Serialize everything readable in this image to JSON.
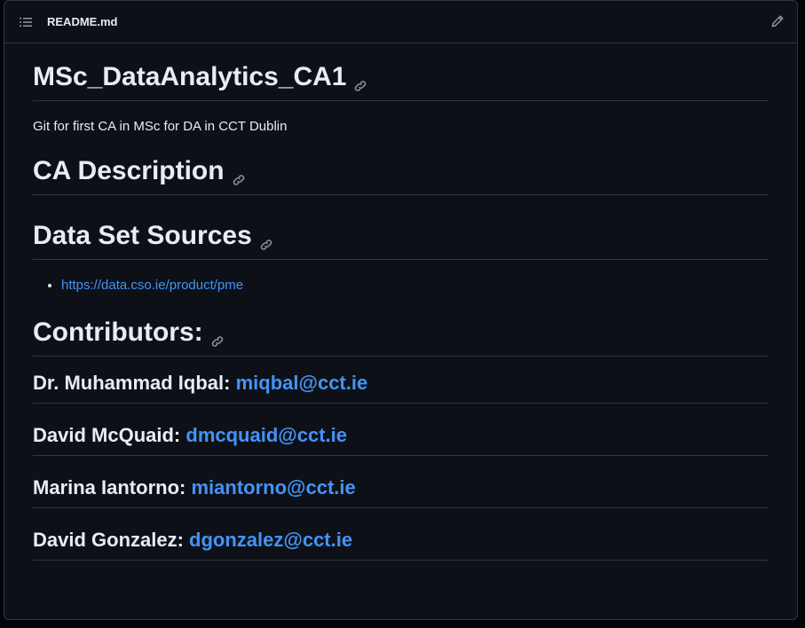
{
  "header": {
    "file_name": "README.md",
    "outline_icon": "list-unordered-icon",
    "edit_icon": "pencil-icon"
  },
  "readme": {
    "title": "MSc_DataAnalytics_CA1",
    "description": "Git for first CA in MSc for DA in CCT Dublin",
    "sections": {
      "ca_description": "CA Description",
      "data_sources": "Data Set Sources",
      "contributors": "Contributors:"
    },
    "source_links": [
      {
        "text": "https://data.cso.ie/product/pme"
      }
    ],
    "contributors": [
      {
        "name": "Dr. Muhammad Iqbal:",
        "email": "miqbal@cct.ie"
      },
      {
        "name": "David McQuaid:",
        "email": "dmcquaid@cct.ie"
      },
      {
        "name": "Marina Iantorno:",
        "email": "miantorno@cct.ie"
      },
      {
        "name": "David Gonzalez:",
        "email": "dgonzalez@cct.ie"
      }
    ]
  },
  "colors": {
    "background": "#0d1117",
    "border": "#30363d",
    "text": "#e6edf3",
    "link": "#4493f8"
  }
}
